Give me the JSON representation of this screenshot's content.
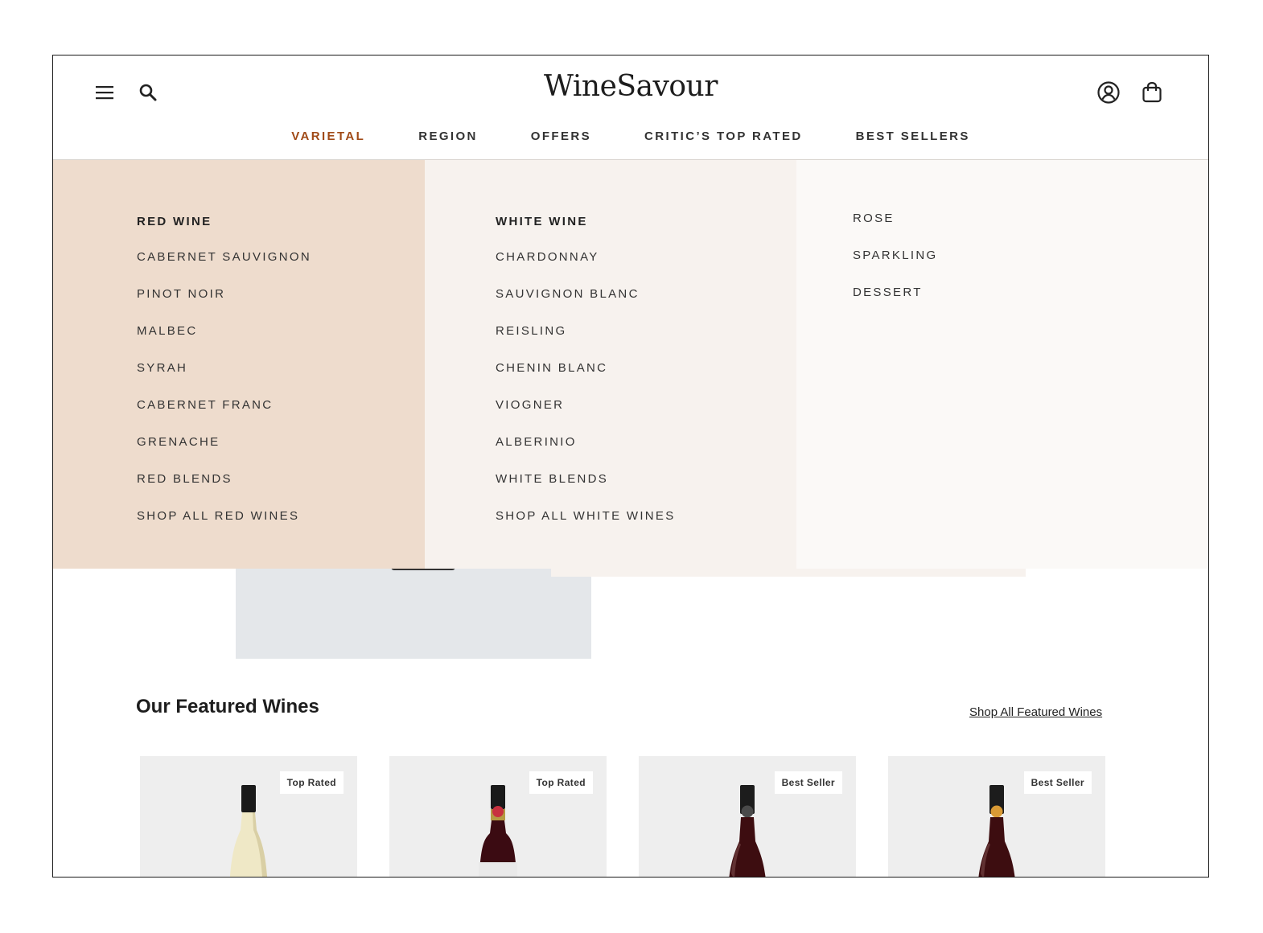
{
  "header": {
    "logo": "WineSavour",
    "icons": [
      "menu-icon",
      "search-icon",
      "account-icon",
      "bag-icon"
    ]
  },
  "nav": {
    "items": [
      {
        "label": "VARIETAL",
        "active": true
      },
      {
        "label": "REGION",
        "active": false
      },
      {
        "label": "OFFERS",
        "active": false
      },
      {
        "label": "CRITIC’S TOP RATED",
        "active": false
      },
      {
        "label": "BEST SELLERS",
        "active": false
      }
    ]
  },
  "mega_menu": {
    "red": {
      "heading": "RED WINE",
      "items": [
        "CABERNET SAUVIGNON",
        "PINOT NOIR",
        "MALBEC",
        "SYRAH",
        "CABERNET FRANC",
        "GRENACHE",
        "RED BLENDS",
        "SHOP ALL RED WINES"
      ]
    },
    "white": {
      "heading": "WHITE WINE",
      "items": [
        "CHARDONNAY",
        "SAUVIGNON BLANC",
        "REISLING",
        "CHENIN BLANC",
        "VIOGNER",
        "ALBERINIO",
        "WHITE BLENDS",
        "SHOP ALL WHITE WINES"
      ]
    },
    "other": {
      "items": [
        "ROSE",
        "SPARKLING",
        "DESSERT"
      ]
    }
  },
  "featured": {
    "title": "Our Featured Wines",
    "link": "Shop All Featured Wines",
    "cards": [
      {
        "badge": "Top Rated",
        "bottle": "white-wine-bottle"
      },
      {
        "badge": "Top Rated",
        "bottle": "red-wine-bottle-labeled"
      },
      {
        "badge": "Best Seller",
        "bottle": "red-wine-bottle"
      },
      {
        "badge": "Best Seller",
        "bottle": "red-wine-bottle"
      }
    ]
  },
  "colors": {
    "accent": "#a04a17",
    "red_column": "#eedccd",
    "white_column": "#f7f2ee",
    "other_column": "#fbf9f7"
  }
}
